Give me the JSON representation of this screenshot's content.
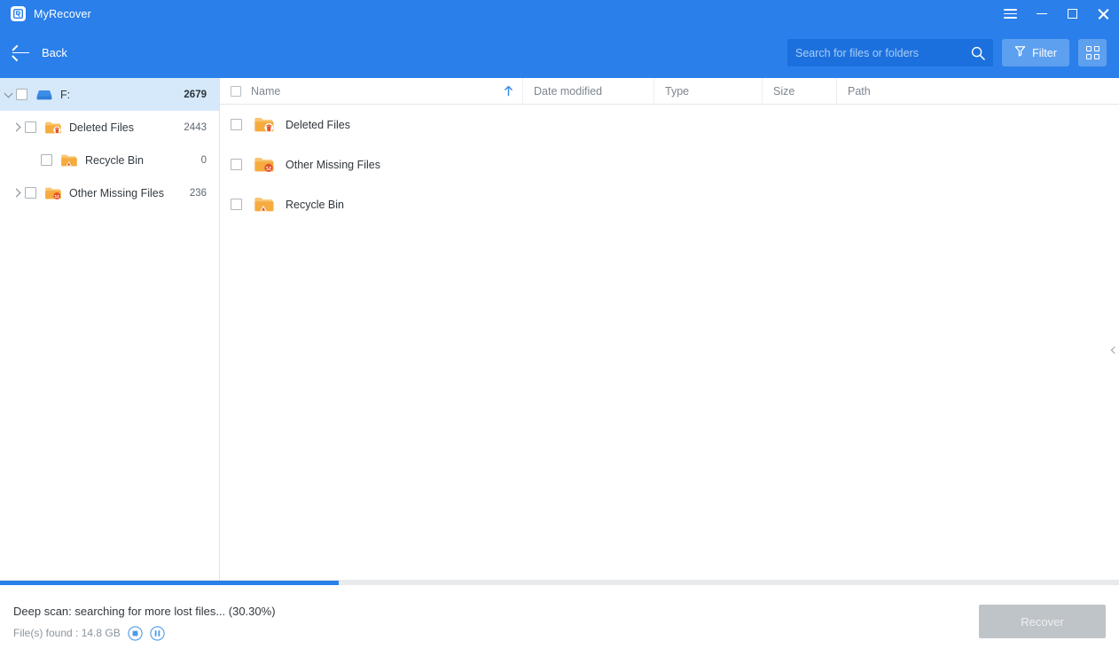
{
  "window": {
    "app_title": "MyRecover",
    "logo_icon": "myrecover-logo-icon",
    "menu_icon": "hamburger-menu-icon",
    "minimize_icon": "minimize-icon",
    "maximize_icon": "maximize-icon",
    "close_icon": "close-icon"
  },
  "toolbar": {
    "back_label": "Back",
    "back_icon": "arrow-left-icon",
    "search_placeholder": "Search for files or folders",
    "search_value": "",
    "search_icon": "search-icon",
    "filter_label": "Filter",
    "filter_icon": "funnel-icon",
    "grid_view_icon": "grid-view-icon"
  },
  "sidebar": {
    "items": [
      {
        "label": "F:",
        "count": "2679",
        "icon": "drive-icon",
        "level": 0,
        "expanded": true,
        "has_children": true,
        "selected": true
      },
      {
        "label": "Deleted Files",
        "count": "2443",
        "icon": "folder-deleted-icon",
        "level": 1,
        "expanded": false,
        "has_children": true,
        "selected": false
      },
      {
        "label": "Recycle Bin",
        "count": "0",
        "icon": "folder-recyclebin-icon",
        "level": 2,
        "expanded": false,
        "has_children": false,
        "selected": false
      },
      {
        "label": "Other Missing Files",
        "count": "236",
        "icon": "folder-missing-icon",
        "level": 1,
        "expanded": false,
        "has_children": true,
        "selected": false
      }
    ]
  },
  "file_list": {
    "columns": [
      {
        "key": "name",
        "label": "Name",
        "sorted": true,
        "sort_direction": "asc"
      },
      {
        "key": "date",
        "label": "Date modified",
        "sorted": false
      },
      {
        "key": "type",
        "label": "Type",
        "sorted": false
      },
      {
        "key": "size",
        "label": "Size",
        "sorted": false
      },
      {
        "key": "path",
        "label": "Path",
        "sorted": false
      }
    ],
    "sort_icon": "sort-ascending-icon",
    "rows": [
      {
        "name": "Deleted Files",
        "icon": "folder-deleted-icon",
        "date": "",
        "type": "",
        "size": "",
        "path": "",
        "checked": false
      },
      {
        "name": "Other Missing Files",
        "icon": "folder-missing-icon",
        "date": "",
        "type": "",
        "size": "",
        "path": "",
        "checked": false
      },
      {
        "name": "Recycle Bin",
        "icon": "folder-recyclebin-icon",
        "date": "",
        "type": "",
        "size": "",
        "path": "",
        "checked": false
      }
    ]
  },
  "panel": {
    "collapse_icon": "chevron-left-icon"
  },
  "status": {
    "message": "Deep scan: searching for more lost files... (30.30%)",
    "progress_percent": 30.3,
    "files_found_label": "File(s) found : 14.8 GB",
    "stop_icon": "stop-icon",
    "pause_icon": "pause-icon",
    "recover_label": "Recover",
    "recover_enabled": false
  },
  "colors": {
    "brand_blue": "#2a7fea",
    "search_field": "#1c70de",
    "button_blue": "#5ea0f0",
    "selection_blue": "#d6e9fb",
    "folder_orange": "#f5b24a",
    "progress_blue": "#2a7fea",
    "disabled_gray": "#bfc4c9"
  }
}
